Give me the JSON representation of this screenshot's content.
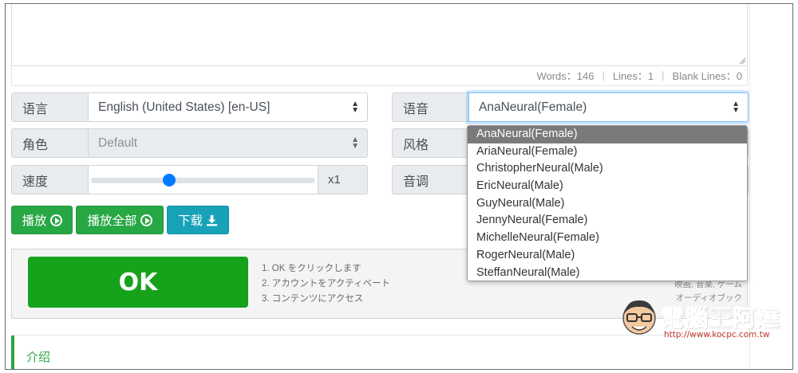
{
  "stats": {
    "words": "Words：146",
    "lines": "Lines：1",
    "blank_lines": "Blank Lines：0",
    "separator": "|"
  },
  "language": {
    "label": "语言",
    "value": "English (United States) [en-US]"
  },
  "voice": {
    "label": "语音",
    "value": "AnaNeural(Female)"
  },
  "role": {
    "label": "角色",
    "value": "Default"
  },
  "style": {
    "label": "风格"
  },
  "speed": {
    "label": "速度",
    "value": "x1",
    "level": 0.34
  },
  "pitch": {
    "label": "音调"
  },
  "buttons": {
    "play": "播放",
    "play_all": "播放全部",
    "download": "下载"
  },
  "voice_options": [
    "AnaNeural(Female)",
    "AriaNeural(Female)",
    "ChristopherNeural(Male)",
    "EricNeural(Male)",
    "GuyNeural(Male)",
    "JennyNeural(Female)",
    "MichelleNeural(Female)",
    "RogerNeural(Male)",
    "SteffanNeural(Male)"
  ],
  "ad": {
    "ok_label": "OK",
    "steps": [
      "1. OK をクリックします",
      "2. アカウントをアクティベート",
      "3. コンテンツにアクセス"
    ],
    "side_lines": [
      "映画, 音楽, ゲーム",
      "オーディオブック"
    ]
  },
  "intro": {
    "title": "介绍"
  },
  "watermark": {
    "title": "電腦王阿達",
    "url": "http://www.kocpc.com.tw"
  },
  "colors": {
    "green": "#28a745",
    "teal": "#17a2b8",
    "blue": "#007bff",
    "ok_green": "#16a21a",
    "selected_gray": "#7a7a7a"
  }
}
